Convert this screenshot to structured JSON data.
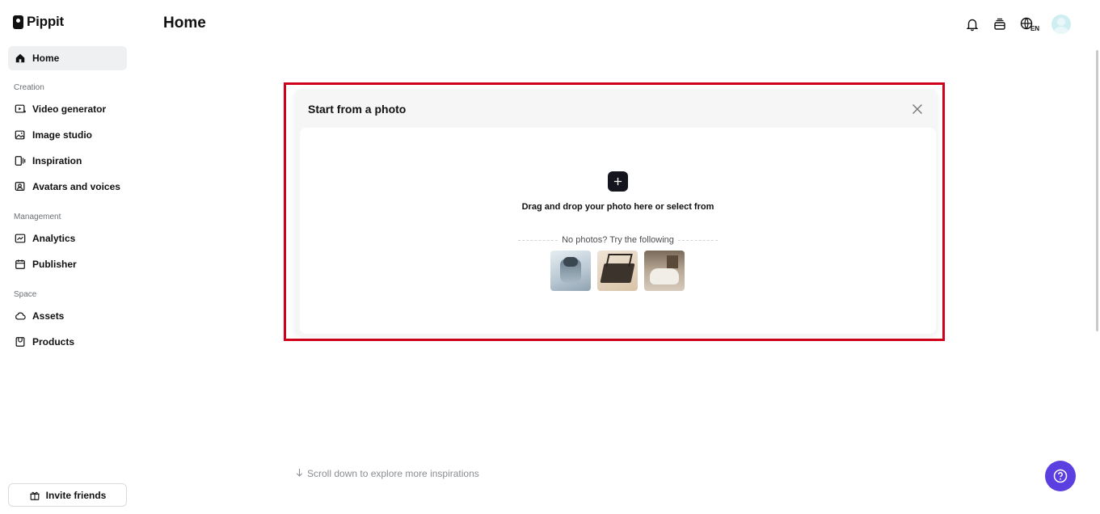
{
  "app": {
    "name": "Pippit"
  },
  "header": {
    "title": "Home",
    "language": "EN"
  },
  "sidebar": {
    "items": [
      {
        "label": "Home",
        "icon": "home-icon",
        "active": true
      },
      {
        "section": "Creation"
      },
      {
        "label": "Video generator",
        "icon": "video-generator-icon"
      },
      {
        "label": "Image studio",
        "icon": "image-studio-icon"
      },
      {
        "label": "Inspiration",
        "icon": "inspiration-icon"
      },
      {
        "label": "Avatars and voices",
        "icon": "avatar-voice-icon"
      },
      {
        "section": "Management"
      },
      {
        "label": "Analytics",
        "icon": "analytics-icon"
      },
      {
        "label": "Publisher",
        "icon": "calendar-icon"
      },
      {
        "section": "Space"
      },
      {
        "label": "Assets",
        "icon": "cloud-icon"
      },
      {
        "label": "Products",
        "icon": "product-box-icon"
      }
    ],
    "invite_label": "Invite friends"
  },
  "card": {
    "title": "Start from a photo",
    "drop_text": "Drag and drop your photo here or select from",
    "try_text": "No photos? Try the following",
    "samples": [
      "earbuds-sample",
      "makeup-palette-sample",
      "armchair-sample"
    ]
  },
  "footer": {
    "scroll_hint": "Scroll down to explore more inspirations"
  },
  "colors": {
    "accent": "#5b3fe0",
    "highlight": "#d0021b",
    "active_bg": "#eef0f2"
  }
}
